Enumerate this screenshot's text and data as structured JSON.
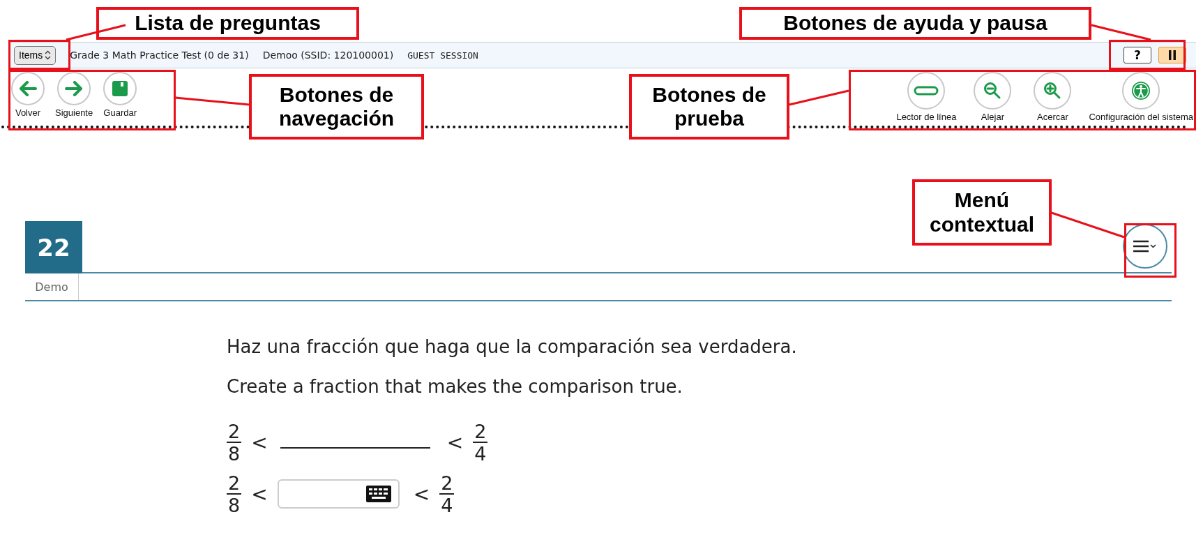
{
  "top_bar": {
    "items_button": "Items",
    "test_title": "Grade 3 Math Practice Test (0 de 31)",
    "student": "Demoo (SSID: 120100001)",
    "session": "GUEST SESSION"
  },
  "top_actions": [
    {
      "kind": "help",
      "label": "?"
    },
    {
      "kind": "pause"
    }
  ],
  "nav_buttons": [
    {
      "kind": "back",
      "label": "Volver"
    },
    {
      "kind": "next",
      "label": "Siguiente"
    },
    {
      "kind": "save",
      "label": "Guardar"
    }
  ],
  "tool_buttons": [
    {
      "kind": "line-reader",
      "label": "Lector de línea"
    },
    {
      "kind": "zoom-out",
      "label": "Alejar"
    },
    {
      "kind": "zoom-in",
      "label": "Acercar"
    },
    {
      "kind": "settings",
      "label": "Configuración del sistema"
    }
  ],
  "question": {
    "number": "22",
    "tag": "Demo",
    "prompts": [
      "Haz una fracción que haga que la comparación sea verdadera.",
      "Create a fraction that makes the comparison true."
    ],
    "rows": [
      {
        "kind": "blank",
        "left": {
          "num": "2",
          "den": "8"
        },
        "op_left": "<",
        "op_right": "<",
        "right": {
          "num": "2",
          "den": "4"
        }
      },
      {
        "kind": "input",
        "left": {
          "num": "2",
          "den": "8"
        },
        "op_left": "<",
        "op_right": "<",
        "right": {
          "num": "2",
          "den": "4"
        }
      }
    ]
  },
  "annotations": [
    {
      "kind": "items",
      "text": "Lista de preguntas"
    },
    {
      "kind": "nav",
      "text": "Botones de navegación"
    },
    {
      "kind": "help",
      "text": "Botones de ayuda y pausa"
    },
    {
      "kind": "tools",
      "text": "Botones de prueba"
    },
    {
      "kind": "menu",
      "text": "Menú contextual"
    }
  ]
}
